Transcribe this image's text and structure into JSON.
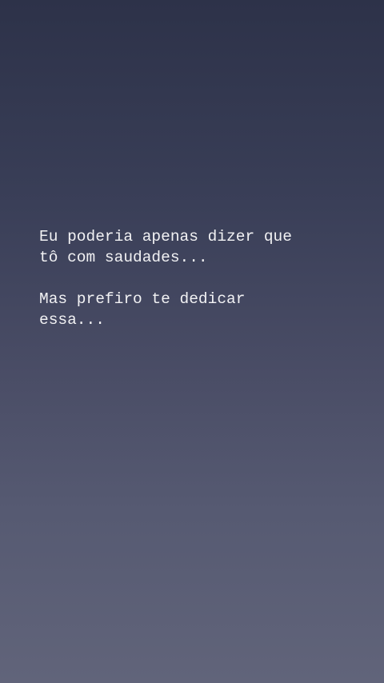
{
  "story": {
    "lines": [
      "Eu poderia apenas dizer que",
      "tô com saudades...",
      "Mas prefiro te dedicar",
      "essa..."
    ]
  }
}
